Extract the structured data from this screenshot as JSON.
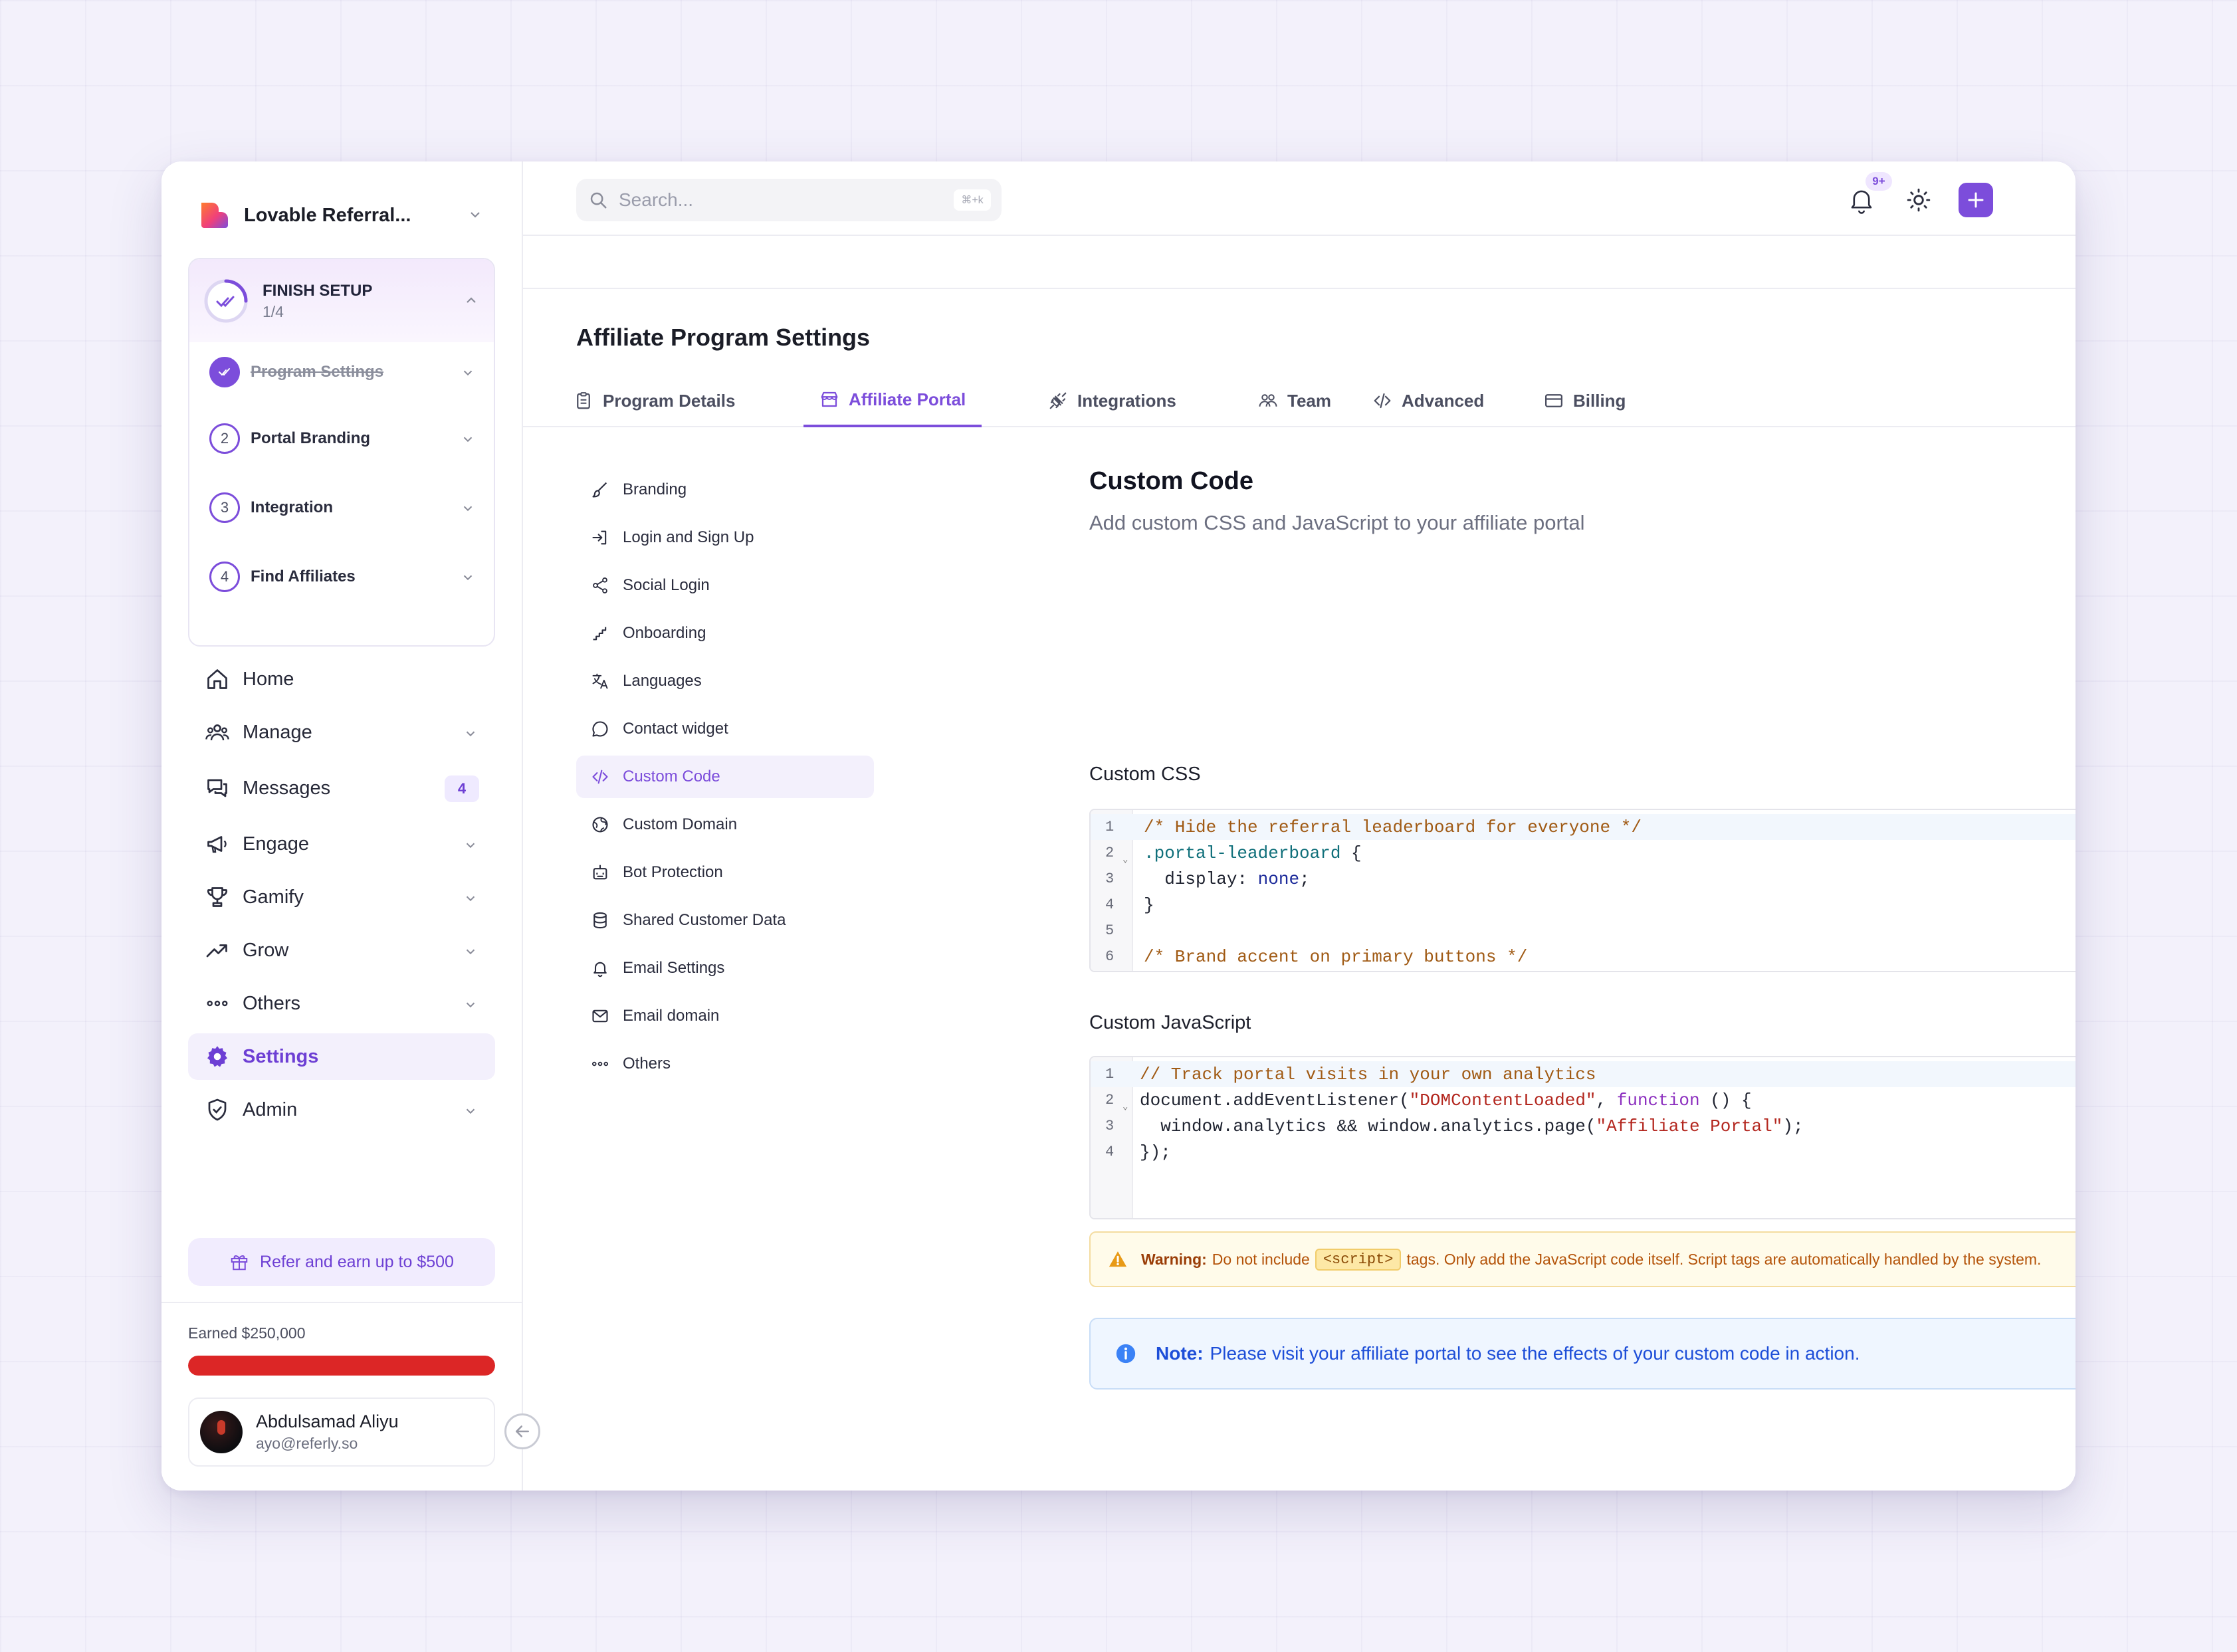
{
  "sidebar": {
    "brand": "Lovable Referral...",
    "setup": {
      "title": "FINISH SETUP",
      "count": "1/4",
      "steps": [
        {
          "label": "Program Settings",
          "num": "",
          "done": true
        },
        {
          "label": "Portal Branding",
          "num": "2",
          "done": false
        },
        {
          "label": "Integration",
          "num": "3",
          "done": false
        },
        {
          "label": "Find Affiliates",
          "num": "4",
          "done": false
        }
      ]
    },
    "nav": [
      {
        "label": "Home",
        "icon": "home-icon"
      },
      {
        "label": "Manage",
        "icon": "users-icon"
      },
      {
        "label": "Messages",
        "icon": "messages-icon",
        "badge": "4"
      },
      {
        "label": "Engage",
        "icon": "megaphone-icon"
      },
      {
        "label": "Gamify",
        "icon": "trophy-icon"
      },
      {
        "label": "Grow",
        "icon": "trending-up-icon"
      },
      {
        "label": "Others",
        "icon": "more-icon"
      },
      {
        "label": "Settings",
        "icon": "gear-icon"
      },
      {
        "label": "Admin",
        "icon": "shield-icon"
      }
    ],
    "refer_label": "Refer and earn up to $500",
    "earned_label": "Earned $250,000",
    "earned_progress": 1.0,
    "user": {
      "name": "Abdulsamad Aliyu",
      "email": "ayo@referly.so"
    }
  },
  "topbar": {
    "search_placeholder": "Search...",
    "search_shortcut": "⌘+k",
    "notif_badge": "9+"
  },
  "page": {
    "title": "Affiliate Program Settings",
    "tabs": [
      {
        "label": "Program Details",
        "icon": "clipboard-icon"
      },
      {
        "label": "Affiliate Portal",
        "icon": "store-icon"
      },
      {
        "label": "Integrations",
        "icon": "plug-icon"
      },
      {
        "label": "Team",
        "icon": "team-icon"
      },
      {
        "label": "Advanced",
        "icon": "code-icon"
      },
      {
        "label": "Billing",
        "icon": "card-icon"
      }
    ],
    "submenu": [
      {
        "label": "Branding",
        "icon": "brush-icon"
      },
      {
        "label": "Login and Sign Up",
        "icon": "login-icon"
      },
      {
        "label": "Social Login",
        "icon": "share-icon"
      },
      {
        "label": "Onboarding",
        "icon": "steps-icon"
      },
      {
        "label": "Languages",
        "icon": "translate-icon"
      },
      {
        "label": "Contact widget",
        "icon": "chat-icon"
      },
      {
        "label": "Custom Code",
        "icon": "code-icon"
      },
      {
        "label": "Custom Domain",
        "icon": "globe-icon"
      },
      {
        "label": "Bot Protection",
        "icon": "bot-icon"
      },
      {
        "label": "Shared Customer Data",
        "icon": "database-icon"
      },
      {
        "label": "Email Settings",
        "icon": "bell-icon"
      },
      {
        "label": "Email domain",
        "icon": "mail-icon"
      },
      {
        "label": "Others",
        "icon": "more-icon"
      }
    ]
  },
  "content": {
    "title": "Custom Code",
    "subtitle": "Add custom CSS and JavaScript to your affiliate portal",
    "css_label": "Custom CSS",
    "js_label": "Custom JavaScript",
    "css_lines": [
      "/* Hide the referral leaderboard for everyone */",
      ".portal-leaderboard {",
      "  display: none;",
      "}",
      "",
      "/* Brand accent on primary buttons */"
    ],
    "js_lines": [
      "// Track portal visits in your own analytics",
      "document.addEventListener(\"DOMContentLoaded\", function () {",
      "  window.analytics && window.analytics.page(\"Affiliate Portal\");",
      "});"
    ],
    "warning": {
      "label": "Warning:",
      "text_before": "Do not include",
      "code": "<script>",
      "text_after": "tags. Only add the JavaScript code itself. Script tags are automatically handled by the system."
    },
    "note": {
      "label": "Note:",
      "text": "Please visit your affiliate portal to see the effects of your custom code in action."
    }
  },
  "colors": {
    "accent": "#7c4ddb",
    "progress": "#dc2626",
    "warning_bg": "#fffbea",
    "note_bg": "#eff6ff"
  }
}
